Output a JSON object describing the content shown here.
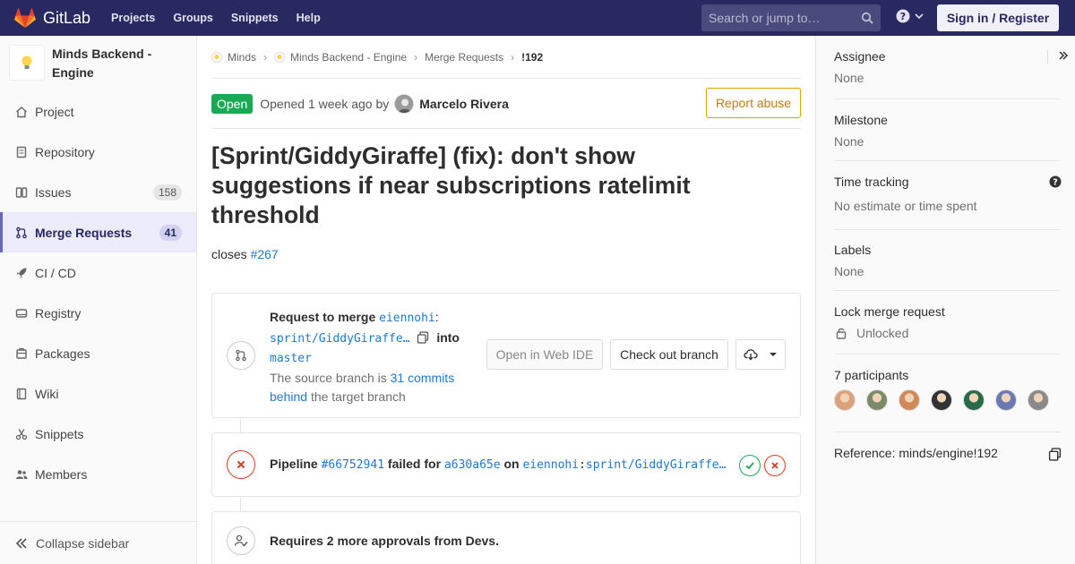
{
  "topnav": {
    "brand": "GitLab",
    "links": [
      "Projects",
      "Groups",
      "Snippets",
      "Help"
    ],
    "search_placeholder": "Search or jump to…",
    "signin_label": "Sign in / Register"
  },
  "sidebar": {
    "project_name": "Minds Backend - Engine",
    "items": [
      {
        "label": "Project",
        "icon": "home-icon"
      },
      {
        "label": "Repository",
        "icon": "doc-icon"
      },
      {
        "label": "Issues",
        "icon": "issues-icon",
        "badge": "158"
      },
      {
        "label": "Merge Requests",
        "icon": "merge-icon",
        "badge": "41",
        "active": true
      },
      {
        "label": "CI / CD",
        "icon": "rocket-icon"
      },
      {
        "label": "Registry",
        "icon": "disk-icon"
      },
      {
        "label": "Packages",
        "icon": "package-icon"
      },
      {
        "label": "Wiki",
        "icon": "book-icon"
      },
      {
        "label": "Snippets",
        "icon": "scissors-icon"
      },
      {
        "label": "Members",
        "icon": "users-icon"
      }
    ],
    "collapse_label": "Collapse sidebar"
  },
  "breadcrumbs": [
    "Minds",
    "Minds Backend - Engine",
    "Merge Requests",
    "!192"
  ],
  "mr": {
    "status": "Open",
    "opened_prefix": "Opened",
    "opened_time": "1 week ago",
    "opened_by": "by",
    "author": "Marcelo Rivera",
    "report_label": "Report abuse",
    "title": "[Sprint/GiddyGiraffe] (fix): don't show suggestions if near subscriptions ratelimit threshold",
    "desc_prefix": "closes",
    "desc_link": "#267"
  },
  "merge_widget": {
    "request_label": "Request to merge",
    "source_ns": "eiennohi",
    "colon": ":",
    "source_branch": "sprint/GiddyGiraffe…",
    "into_label": "into",
    "target_branch": "master",
    "behind_prefix": "The source branch is",
    "behind_link_1": "31 commits",
    "behind_link_2": "behind",
    "behind_suffix": "the target branch",
    "web_ide_label": "Open in Web IDE",
    "checkout_label": "Check out branch"
  },
  "pipeline": {
    "label": "Pipeline",
    "id": "#66752941",
    "failed_for": "failed for",
    "commit": "a630a65e",
    "on_label": "on",
    "ns": "eiennohi",
    "colon": ":",
    "branch": "sprint/GiddyGiraffe…"
  },
  "approvals": {
    "text": "Requires 2 more approvals from Devs."
  },
  "right_sidebar": {
    "assignee_label": "Assignee",
    "assignee_value": "None",
    "milestone_label": "Milestone",
    "milestone_value": "None",
    "time_label": "Time tracking",
    "time_value": "No estimate or time spent",
    "labels_label": "Labels",
    "labels_value": "None",
    "lock_label": "Lock merge request",
    "lock_value": "Unlocked",
    "participants_label": "7 participants",
    "participant_colors": [
      "#d9a27a",
      "#7a8a6a",
      "#d08a5a",
      "#333333",
      "#2a6a4a",
      "#6a7ab0",
      "#8a8a8a"
    ],
    "reference": "Reference: minds/engine!192"
  },
  "colors": {
    "nav_bg": "#292961",
    "open_green": "#1aaa55",
    "link_blue": "#1f78d1",
    "failed_red": "#db3b21",
    "report_orange": "#c17d10"
  }
}
